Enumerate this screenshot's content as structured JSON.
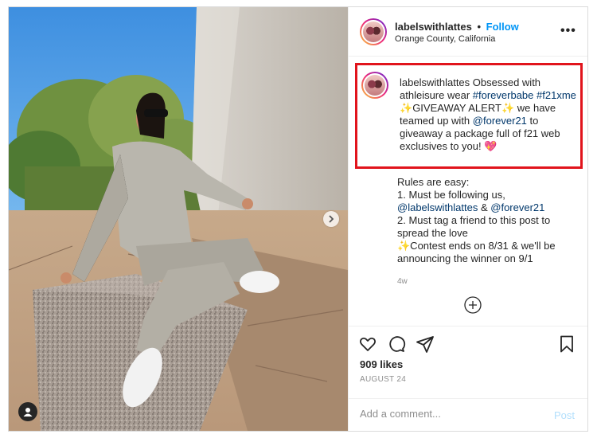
{
  "post": {
    "username": "labelswithlattes",
    "separator": "•",
    "follow_label": "Follow",
    "location": "Orange County, California",
    "more_label": "•••"
  },
  "caption": {
    "username": "labelswithlattes",
    "line1_text": " Obsessed with athleisure wear ",
    "hashtag1": "#foreverbabe",
    "hashtag2": "#f21xme",
    "sparkle": "✨",
    "alert": "GIVEAWAY ALERT",
    "alert_rest": " we have teamed up with ",
    "mention": "@forever21",
    "rest": " to giveaway a package full of f21 web exclusives to you! ",
    "emoji": "💖"
  },
  "rules": {
    "title": "Rules are easy:",
    "line1": "1. Must be following us,",
    "mention1": "@labelswithlattes",
    "amp": " & ",
    "mention2": "@forever21",
    "line3": "2. Must tag a friend to this post to",
    "line4": "spread the love",
    "line5": "✨Contest ends on 8/31 & we'll be",
    "line6": "announcing the winner on 9/1"
  },
  "timestamp": "4w",
  "engagement": {
    "likes": "909 likes",
    "date": "AUGUST 24"
  },
  "comment": {
    "placeholder": "Add a comment...",
    "post_label": "Post"
  },
  "colors": {
    "follow": "#0095f6",
    "highlight_border": "#e1141c",
    "link": "#00376b"
  },
  "icons": [
    "next-arrow-icon",
    "user-tag-icon",
    "more-icon",
    "add-icon",
    "heart-icon",
    "comment-icon",
    "share-icon",
    "bookmark-icon"
  ]
}
